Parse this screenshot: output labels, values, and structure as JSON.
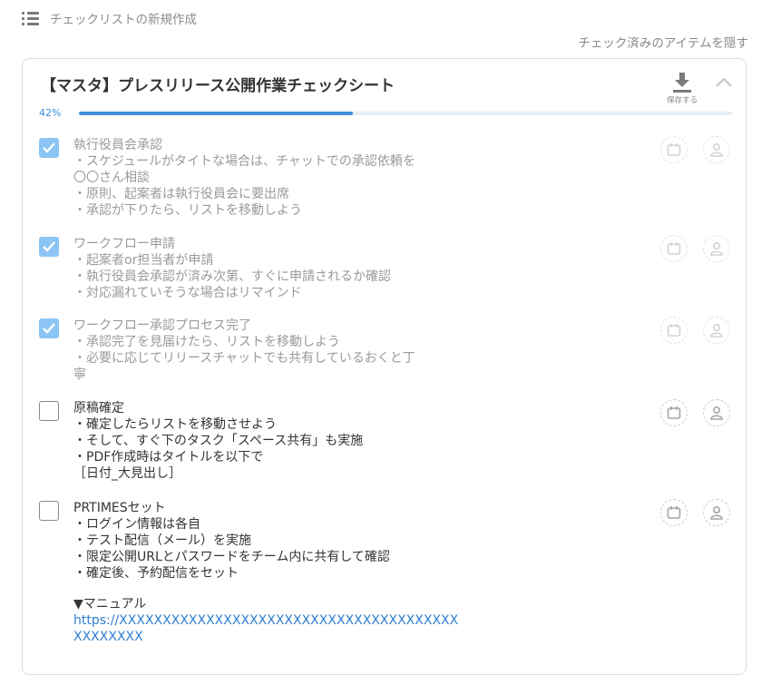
{
  "header": {
    "title": "チェックリストの新規作成",
    "icon": "list-icon"
  },
  "hide_checked_label": "チェック済みのアイテムを隠す",
  "card": {
    "title": "【マスタ】プレスリリース公開作業チェックシート",
    "save_label": "保存する",
    "collapse_icon": "chevron-up-icon"
  },
  "progress": {
    "label": "42%",
    "value": 42,
    "color": "#3d8fd8"
  },
  "items": [
    {
      "checked": true,
      "title": "執行役員会承認",
      "lines": [
        "・スケジュールがタイトな場合は、チャットでの承認依頼を",
        "〇〇さん相談",
        "・原則、起案者は執行役員会に要出席",
        "・承認が下りたら、リストを移動しよう"
      ]
    },
    {
      "checked": true,
      "title": "ワークフロー申請",
      "lines": [
        "・起案者or担当者が申請",
        "・執行役員会承認が済み次第、すぐに申請されるか確認",
        "・対応漏れていそうな場合はリマインド"
      ]
    },
    {
      "checked": true,
      "title": "ワークフロー承認プロセス完了",
      "lines": [
        "・承認完了を見届けたら、リストを移動しよう",
        "・必要に応じてリリースチャットでも共有しているおくと丁",
        "寧"
      ]
    },
    {
      "checked": false,
      "title": "原稿確定",
      "lines": [
        "・確定したらリストを移動させよう",
        "・そして、すぐ下のタスク「スペース共有」も実施",
        "・PDF作成時はタイトルを以下で",
        "［日付_大見出し］"
      ]
    },
    {
      "checked": false,
      "title": "PRTIMESセット",
      "lines": [
        "・ログイン情報は各自",
        "・テスト配信（メール）を実施",
        "・限定公開URLとパスワードをチーム内に共有して確認",
        "・確定後、予約配信をセット"
      ],
      "manual_label": "▼マニュアル",
      "manual_link_1": "https://XXXXXXXXXXXXXXXXXXXXXXXXXXXXXXXXXXXXXXX",
      "manual_link_2": "XXXXXXXX"
    }
  ],
  "icons": {
    "deadline": "calendar-icon",
    "assignee": "user-icon",
    "checkmark": "check-icon",
    "save": "download-icon"
  },
  "colors": {
    "checked_box": "#8cc5f4",
    "link": "#2f7fd1",
    "progress": "#3d8fd8"
  }
}
